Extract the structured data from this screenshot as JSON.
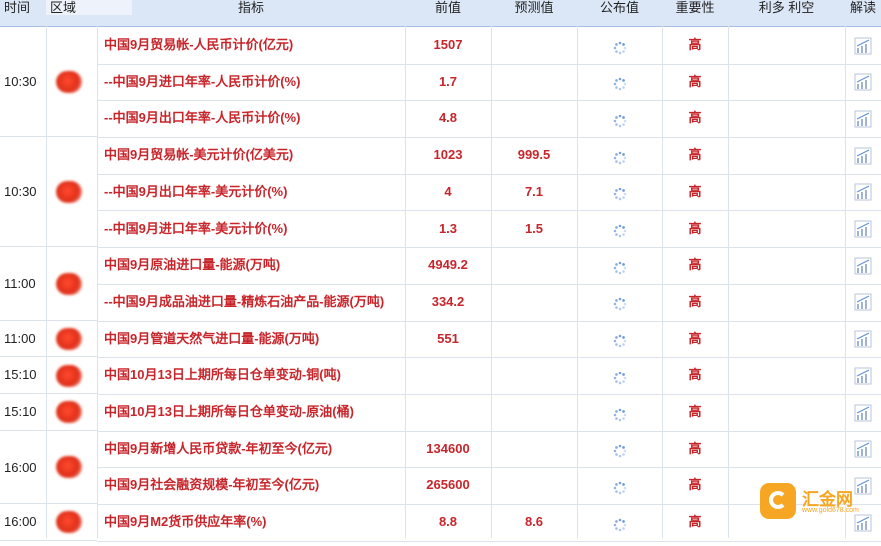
{
  "header": {
    "time": "时间",
    "region": "区域",
    "indicator": "指标",
    "previous": "前值",
    "forecast": "预测值",
    "published": "公布值",
    "importance": "重要性",
    "bull_bear": "利多 利空",
    "interpret": "解读"
  },
  "groups": [
    {
      "time": "10:30",
      "rows": [
        {
          "name": "中国9月贸易帐-人民币计价(亿元)",
          "previous": "1507",
          "forecast": "",
          "importance": "高"
        },
        {
          "name": "--中国9月进口年率-人民币计价(%)",
          "previous": "1.7",
          "forecast": "",
          "importance": "高"
        },
        {
          "name": "--中国9月出口年率-人民币计价(%)",
          "previous": "4.8",
          "forecast": "",
          "importance": "高"
        }
      ]
    },
    {
      "time": "10:30",
      "rows": [
        {
          "name": "中国9月贸易帐-美元计价(亿美元)",
          "previous": "1023",
          "forecast": "999.5",
          "importance": "高"
        },
        {
          "name": "--中国9月出口年率-美元计价(%)",
          "previous": "4",
          "forecast": "7.1",
          "importance": "高"
        },
        {
          "name": "--中国9月进口年率-美元计价(%)",
          "previous": "1.3",
          "forecast": "1.5",
          "importance": "高"
        }
      ]
    },
    {
      "time": "11:00",
      "rows": [
        {
          "name": "中国9月原油进口量-能源(万吨)",
          "previous": "4949.2",
          "forecast": "",
          "importance": "高"
        },
        {
          "name": "--中国9月成品油进口量-精炼石油产品-能源(万吨)",
          "previous": "334.2",
          "forecast": "",
          "importance": "高"
        }
      ]
    },
    {
      "time": "11:00",
      "rows": [
        {
          "name": "中国9月管道天然气进口量-能源(万吨)",
          "previous": "551",
          "forecast": "",
          "importance": "高"
        }
      ]
    },
    {
      "time": "15:10",
      "rows": [
        {
          "name": "中国10月13日上期所每日仓单变动-铜(吨)",
          "previous": "",
          "forecast": "",
          "importance": "高"
        }
      ]
    },
    {
      "time": "15:10",
      "rows": [
        {
          "name": "中国10月13日上期所每日仓单变动-原油(桶)",
          "previous": "",
          "forecast": "",
          "importance": "高"
        }
      ]
    },
    {
      "time": "16:00",
      "rows": [
        {
          "name": "中国9月新增人民币贷款-年初至今(亿元)",
          "previous": "134600",
          "forecast": "",
          "importance": "高"
        },
        {
          "name": "中国9月社会融资规模-年初至今(亿元)",
          "previous": "265600",
          "forecast": "",
          "importance": "高"
        }
      ]
    },
    {
      "time": "16:00",
      "rows": [
        {
          "name": "中国9月M2货币供应年率(%)",
          "previous": "8.8",
          "forecast": "8.6",
          "importance": "高"
        }
      ]
    }
  ],
  "watermark": {
    "name": "汇金网",
    "url": "www.gold678.com"
  },
  "colors": {
    "value_red": "#c8252b",
    "header_bg": "#dbe7f7",
    "accent_orange": "#f6a623"
  },
  "icons": {
    "published": "loading-spinner-icon",
    "interpret": "chart-icon",
    "region": "china-flag-icon"
  }
}
